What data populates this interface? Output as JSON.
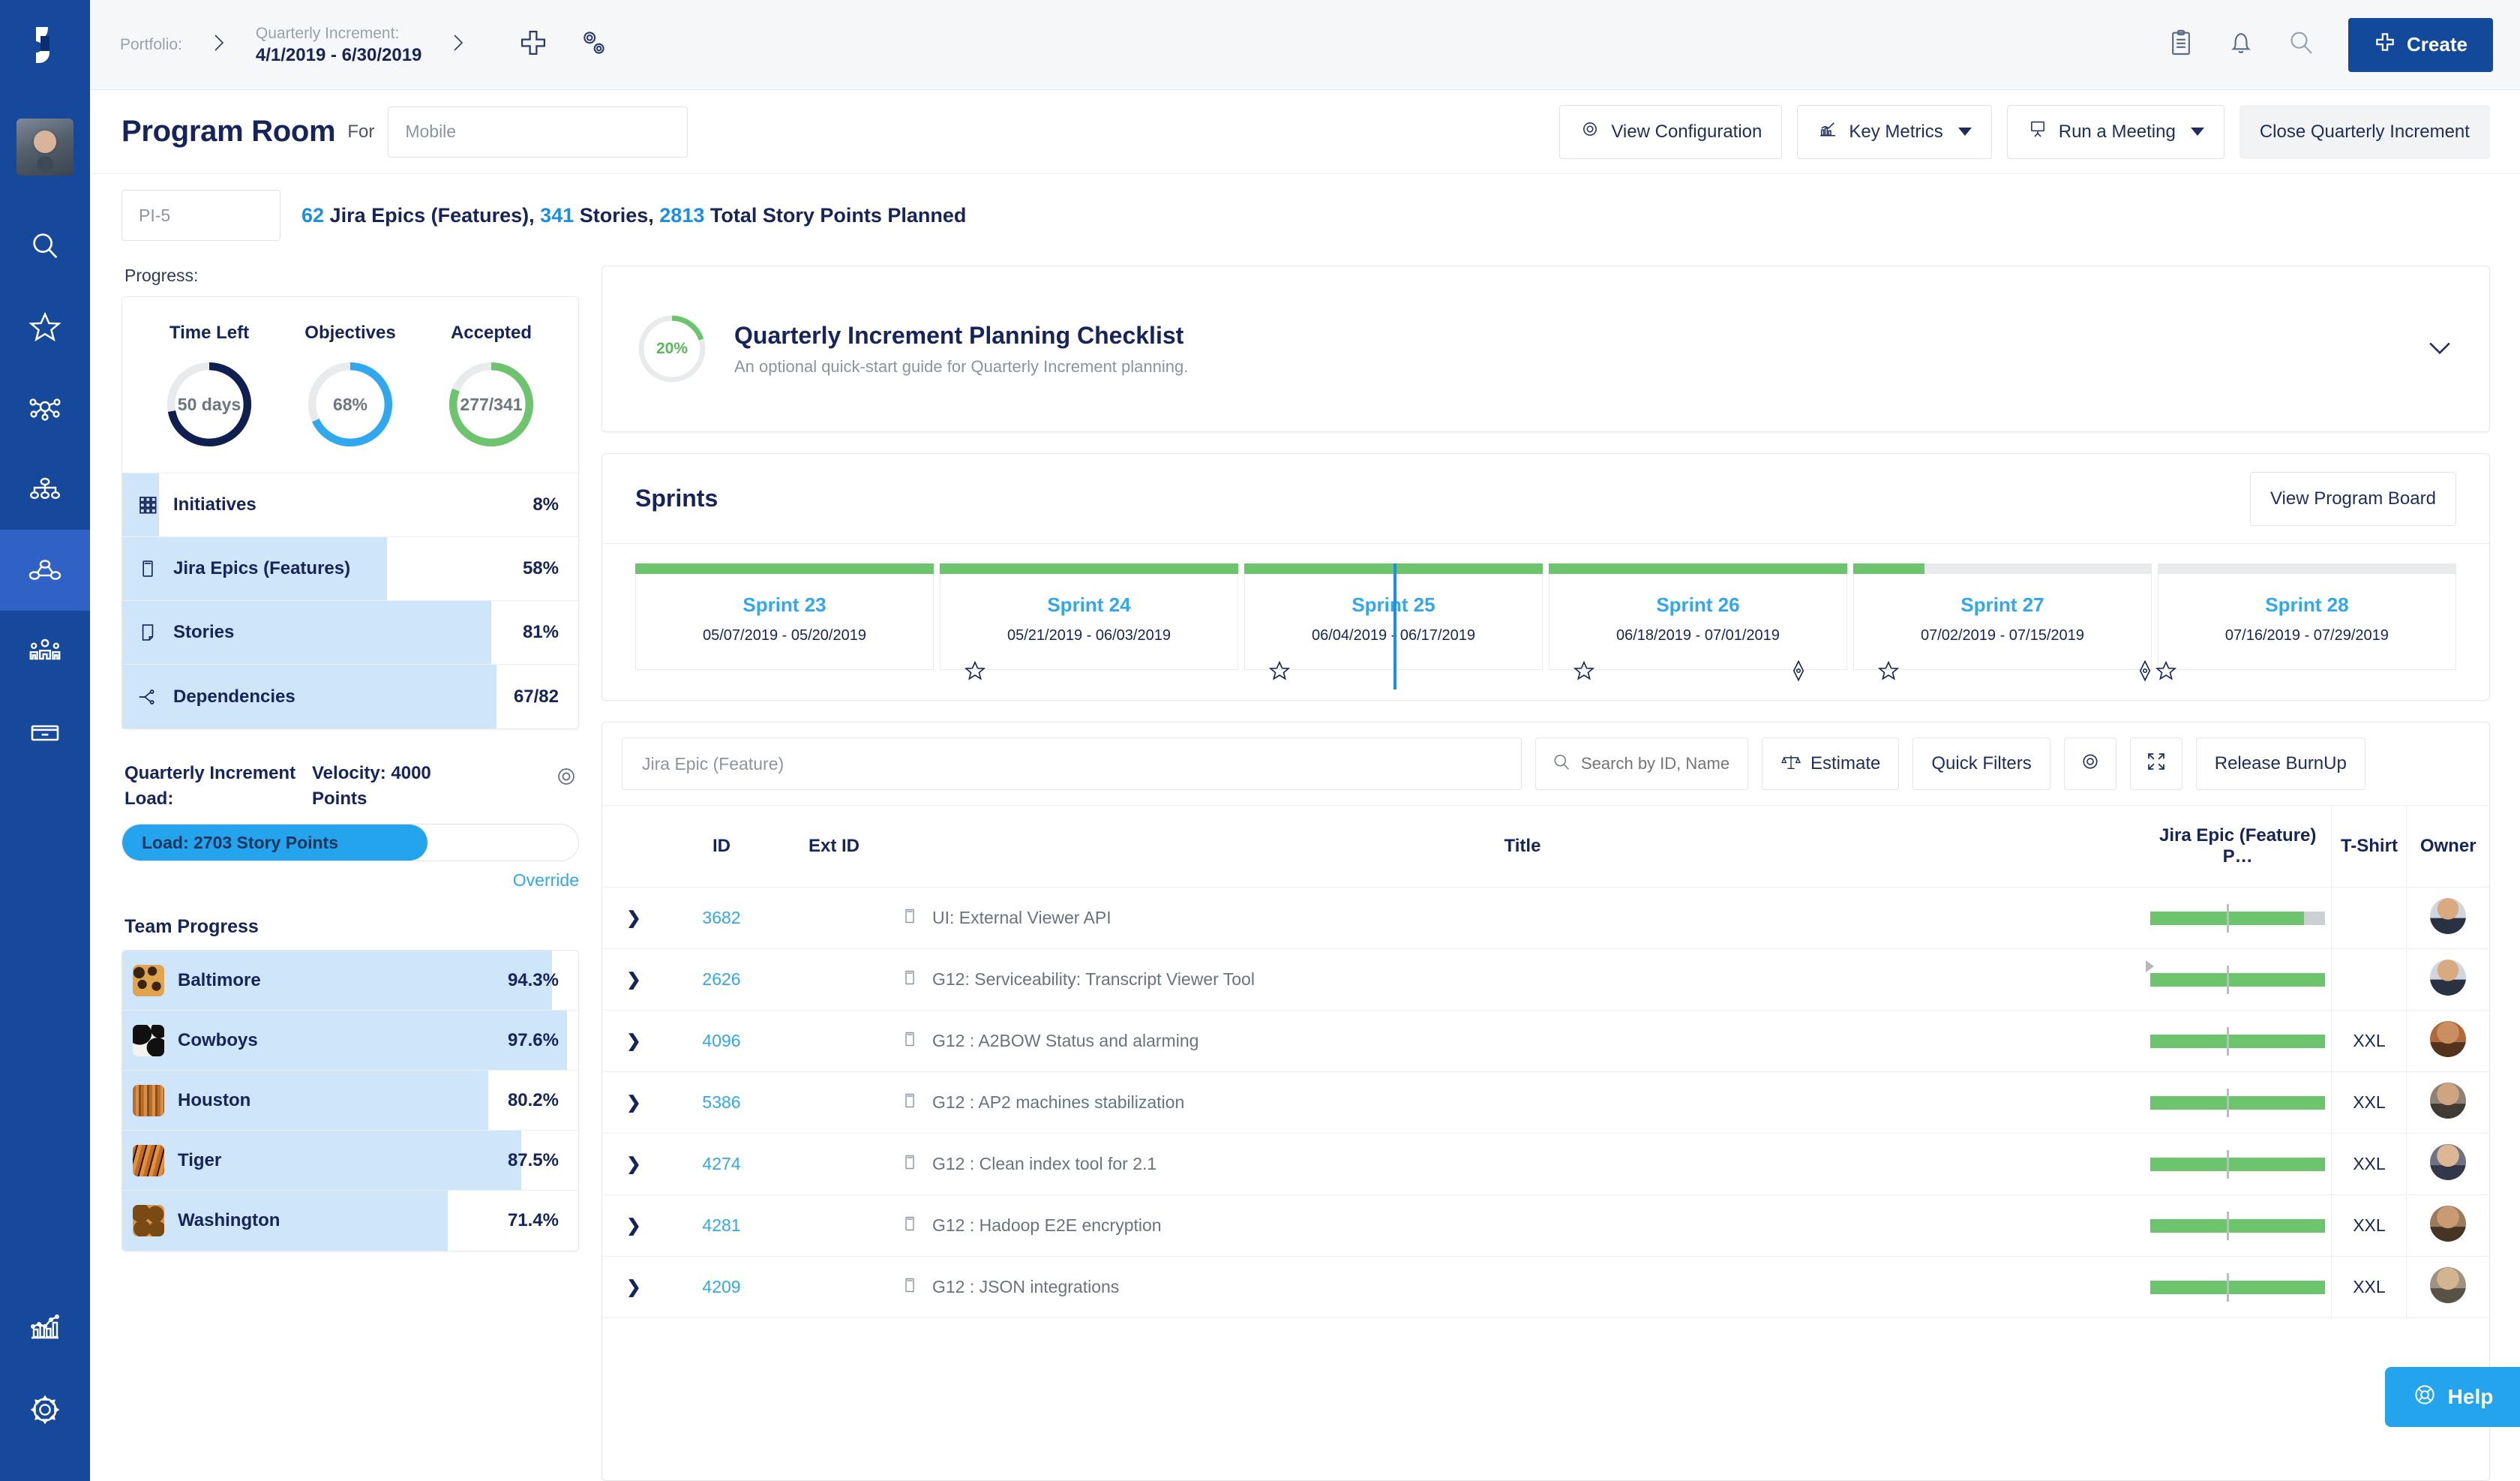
{
  "brand": {
    "primary": "#12499b",
    "accent": "#2fa8f0",
    "green": "#6cc46c",
    "navy": "#16245c"
  },
  "rail": {
    "logo_icon": "jira-align-logo-icon",
    "avatar_name": "user-avatar",
    "items": [
      {
        "name": "search",
        "icon": "search-icon",
        "active": false
      },
      {
        "name": "favorites",
        "icon": "star-icon",
        "active": false
      },
      {
        "name": "network",
        "icon": "network-hub-icon",
        "active": false
      },
      {
        "name": "hierarchy",
        "icon": "org-tree-icon",
        "active": false
      },
      {
        "name": "program-room",
        "icon": "program-nodes-icon",
        "active": true
      },
      {
        "name": "teams",
        "icon": "people-group-icon",
        "active": false
      },
      {
        "name": "boxes",
        "icon": "drawer-icon",
        "active": false
      },
      {
        "name": "reports",
        "icon": "bar-chart-icon",
        "active": false
      },
      {
        "name": "settings",
        "icon": "gear-icon",
        "active": false
      }
    ]
  },
  "topbar": {
    "portfolio_label": "Portfolio:",
    "portfolio_value": "",
    "increment_label": "Quarterly Increment:",
    "increment_value": "4/1/2019 - 6/30/2019",
    "add_icon": "plus-icon",
    "settings_icon": "gears-icon",
    "clipboard_icon": "clipboard-icon",
    "bell_icon": "bell-icon",
    "search_icon": "search-icon",
    "create_label": "Create"
  },
  "header": {
    "title": "Program Room",
    "for_label": "For",
    "program_value": "Mobile",
    "buttons": [
      {
        "label": "View Configuration",
        "icon": "gear-icon",
        "caret": false,
        "ghost": false
      },
      {
        "label": "Key Metrics",
        "icon": "chart-up-icon",
        "caret": true,
        "ghost": false
      },
      {
        "label": "Run a Meeting",
        "icon": "presentation-board-icon",
        "caret": true,
        "ghost": false
      },
      {
        "label": "Close Quarterly Increment",
        "icon": "",
        "caret": false,
        "ghost": true
      }
    ]
  },
  "pi_row": {
    "pi_value": "PI-5",
    "epics_count": "62",
    "epics_label": " Jira Epics (Features), ",
    "stories_count": "341",
    "stories_label": " Stories, ",
    "points_count": "2813",
    "points_label": " Total Story Points Planned"
  },
  "progress": {
    "section_label": "Progress:",
    "donuts": [
      {
        "title": "Time Left",
        "value": "50 days",
        "pct": 72,
        "color": "#0f1f4f"
      },
      {
        "title": "Objectives",
        "value": "68%",
        "pct": 68,
        "color": "#2fa8f0"
      },
      {
        "title": "Accepted",
        "value": "277/341",
        "pct": 81,
        "color": "#6cc46c"
      }
    ],
    "rows": [
      {
        "icon": "grid-icon",
        "label": "Initiatives",
        "value": "8%",
        "fill_pct": 8
      },
      {
        "icon": "epic-card-icon",
        "label": "Jira Epics (Features)",
        "value": "58%",
        "fill_pct": 58
      },
      {
        "icon": "story-page-icon",
        "label": "Stories",
        "value": "81%",
        "fill_pct": 81
      },
      {
        "icon": "dependency-icon",
        "label": "Dependencies",
        "value": "67/82",
        "fill_pct": 82
      }
    ]
  },
  "load": {
    "title": "Quarterly Increment Load:",
    "velocity": "Velocity: 4000 Points",
    "gear_icon": "gear-icon",
    "bar_label": "Load: 2703 Story Points",
    "bar_pct": 67,
    "override_label": "Override"
  },
  "team_progress": {
    "heading": "Team Progress",
    "teams": [
      {
        "name": "Baltimore",
        "value": "94.3%",
        "pct": 94.3,
        "swatch": "leopard"
      },
      {
        "name": "Cowboys",
        "value": "97.6%",
        "pct": 97.6,
        "swatch": "cow"
      },
      {
        "name": "Houston",
        "value": "80.2%",
        "pct": 80.2,
        "swatch": "wood"
      },
      {
        "name": "Tiger",
        "value": "87.5%",
        "pct": 87.5,
        "swatch": "tiger"
      },
      {
        "name": "Washington",
        "value": "71.4%",
        "pct": 71.4,
        "swatch": "giraffe"
      }
    ]
  },
  "checklist": {
    "pct_label": "20%",
    "pct": 20,
    "title": "Quarterly Increment Planning Checklist",
    "subtitle": "An optional quick-start guide for Quarterly Increment planning.",
    "chevron_icon": "chevron-down-icon"
  },
  "sprints": {
    "title": "Sprints",
    "view_board_label": "View Program Board",
    "today_position_pct": 53,
    "items": [
      {
        "name": "Sprint 23",
        "dates": "05/07/2019 - 05/20/2019",
        "bar_pct": 100,
        "marks": []
      },
      {
        "name": "Sprint 24",
        "dates": "05/21/2019 - 06/03/2019",
        "bar_pct": 100,
        "marks": [
          {
            "type": "star",
            "x": 12
          }
        ]
      },
      {
        "name": "Sprint 25",
        "dates": "06/04/2019 - 06/17/2019",
        "bar_pct": 100,
        "marks": [
          {
            "type": "star",
            "x": 12
          }
        ]
      },
      {
        "name": "Sprint 26",
        "dates": "06/18/2019 - 07/01/2019",
        "bar_pct": 100,
        "marks": [
          {
            "type": "star",
            "x": 12
          },
          {
            "type": "diamond",
            "x": 86
          }
        ]
      },
      {
        "name": "Sprint 27",
        "dates": "07/02/2019 - 07/15/2019",
        "bar_pct": 24,
        "marks": [
          {
            "type": "star",
            "x": 12
          }
        ]
      },
      {
        "name": "Sprint 28",
        "dates": "07/16/2019 - 07/29/2019",
        "bar_pct": 0,
        "marks": [
          {
            "type": "diamond",
            "x": 74
          },
          {
            "type": "star",
            "x": 82
          }
        ]
      }
    ]
  },
  "epics": {
    "type_filter_value": "Jira Epic (Feature)",
    "search_placeholder": "Search by ID, Name",
    "search_value": "",
    "toolbar": [
      {
        "label": "Estimate",
        "icon": "scales-icon"
      },
      {
        "label": "Quick Filters",
        "icon": ""
      },
      {
        "label": "",
        "icon": "gear-icon"
      },
      {
        "label": "",
        "icon": "expand-icon"
      },
      {
        "label": "Release BurnUp",
        "icon": ""
      }
    ],
    "columns": [
      "",
      "ID",
      "Ext ID",
      "Title",
      "Jira Epic (Feature) P…",
      "T-Shirt",
      "Owner"
    ],
    "rows": [
      {
        "id": "3682",
        "ext_id": "",
        "title": "UI: External Viewer API",
        "progress_done": 72,
        "progress_total": 82,
        "tshirt": "",
        "owner_tone": "#2b2f3a"
      },
      {
        "id": "2626",
        "ext_id": "",
        "title": "G12: Serviceability: Transcript Viewer Tool",
        "progress_done": 95,
        "progress_total": 95,
        "tshirt": "",
        "owner_tone": "#2b2f3a"
      },
      {
        "id": "4096",
        "ext_id": "",
        "title": "G12 : A2BOW Status and alarming",
        "progress_done": 100,
        "progress_total": 100,
        "tshirt": "XXL",
        "owner_tone": "#8a5a3b"
      },
      {
        "id": "5386",
        "ext_id": "",
        "title": "G12 : AP2 machines stabilization",
        "progress_done": 88,
        "progress_total": 88,
        "tshirt": "XXL",
        "owner_tone": "#5a4636"
      },
      {
        "id": "4274",
        "ext_id": "",
        "title": "G12 : Clean index tool for 2.1",
        "progress_done": 92,
        "progress_total": 92,
        "tshirt": "XXL",
        "owner_tone": "#4a4a55"
      },
      {
        "id": "4281",
        "ext_id": "",
        "title": "G12 : Hadoop E2E encryption",
        "progress_done": 100,
        "progress_total": 100,
        "tshirt": "XXL",
        "owner_tone": "#6b4b35"
      },
      {
        "id": "4209",
        "ext_id": "",
        "title": "G12 : JSON integrations",
        "progress_done": 90,
        "progress_total": 90,
        "tshirt": "XXL",
        "owner_tone": "#7a6a58"
      }
    ]
  },
  "help": {
    "label": "Help",
    "icon": "lifebuoy-icon"
  }
}
